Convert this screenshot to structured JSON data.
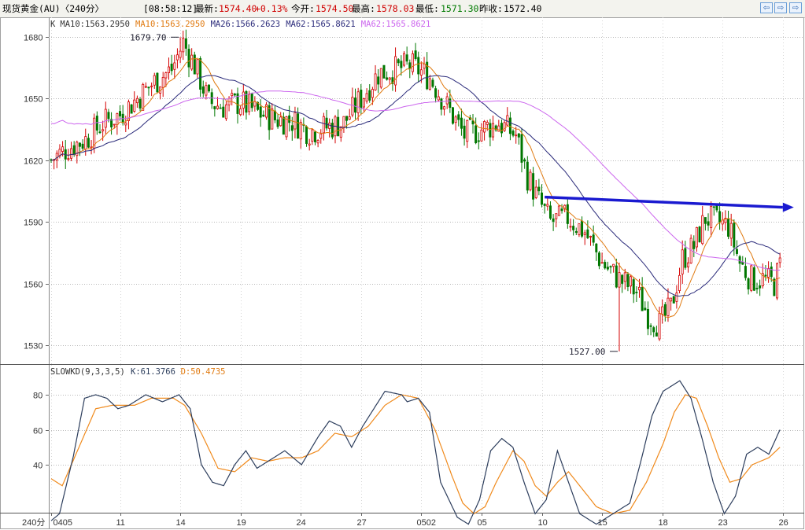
{
  "header": {
    "title": "现货黄金(AU)〈240分〉",
    "time": "[08:58:12]",
    "latest_label": "最新:",
    "latest": "1574.40",
    "change": "+0.13%",
    "open_label": "今开:",
    "open": "1574.50",
    "high_label": "最高:",
    "high": "1578.03",
    "low_label": "最低:",
    "low": "1571.30",
    "prev_label": "昨收:",
    "prev": "1572.40"
  },
  "nav_buttons": [
    "⇦",
    "⇨",
    "⇨"
  ],
  "colors": {
    "up": "#d40000",
    "down": "#007700",
    "ma10": "#e07a10",
    "ma26": "#2a2a7a",
    "ma62": "#cc66ee",
    "k": "#2c3d5c",
    "d": "#f08a1c",
    "arrow": "#1a1ad0",
    "grid": "#b8b8b8"
  },
  "legend_main": [
    {
      "text": "K",
      "color": "#333333"
    },
    {
      "text": "MA10:1563.2950",
      "color": "#333333"
    },
    {
      "text": "MA10:1563.2950",
      "color": "#e07a10"
    },
    {
      "text": "MA26:1566.2623",
      "color": "#2a2a7a"
    },
    {
      "text": "MA62:1565.8621",
      "color": "#2a2a7a"
    },
    {
      "text": "MA62:1565.8621",
      "color": "#cc66ee"
    }
  ],
  "legend_sub": [
    {
      "text": "SLOWKD(9,3,3,5)",
      "color": "#333333"
    },
    {
      "text": "K:61.3766",
      "color": "#2c3d5c"
    },
    {
      "text": "D:50.4735",
      "color": "#e07a10"
    }
  ],
  "chart_data": [
    {
      "type": "candlestick",
      "y_ticks": [
        1530,
        1560,
        1590,
        1620,
        1650,
        1680
      ],
      "ylim": [
        1522,
        1680
      ],
      "x_ticks": [
        {
          "label": "0405",
          "i": 0
        },
        {
          "label": "11",
          "i": 24
        },
        {
          "label": "14",
          "i": 45
        },
        {
          "label": "19",
          "i": 66
        },
        {
          "label": "24",
          "i": 87
        },
        {
          "label": "27",
          "i": 108
        },
        {
          "label": "0502",
          "i": 129
        },
        {
          "label": "05",
          "i": 150
        },
        {
          "label": "10",
          "i": 171
        },
        {
          "label": "15",
          "i": 192
        },
        {
          "label": "18",
          "i": 213
        },
        {
          "label": "23",
          "i": 234
        },
        {
          "label": "26",
          "i": 255
        }
      ],
      "bar_count": 255,
      "x_axis_label": "240分",
      "anchors": [
        [
          0,
          1620
        ],
        [
          6,
          1626
        ],
        [
          12,
          1630
        ],
        [
          18,
          1638
        ],
        [
          24,
          1642
        ],
        [
          30,
          1650
        ],
        [
          36,
          1658
        ],
        [
          42,
          1664
        ],
        [
          46,
          1677
        ],
        [
          50,
          1666
        ],
        [
          55,
          1648
        ],
        [
          60,
          1646
        ],
        [
          66,
          1648
        ],
        [
          72,
          1643
        ],
        [
          78,
          1640
        ],
        [
          84,
          1639
        ],
        [
          90,
          1634
        ],
        [
          96,
          1636
        ],
        [
          102,
          1638
        ],
        [
          108,
          1650
        ],
        [
          114,
          1662
        ],
        [
          120,
          1664
        ],
        [
          125,
          1666
        ],
        [
          128,
          1664
        ],
        [
          132,
          1660
        ],
        [
          138,
          1646
        ],
        [
          144,
          1632
        ],
        [
          150,
          1635
        ],
        [
          156,
          1638
        ],
        [
          162,
          1632
        ],
        [
          166,
          1612
        ],
        [
          170,
          1600
        ],
        [
          174,
          1590
        ],
        [
          180,
          1592
        ],
        [
          186,
          1585
        ],
        [
          192,
          1570
        ],
        [
          198,
          1562
        ],
        [
          204,
          1556
        ],
        [
          208,
          1545
        ],
        [
          212,
          1540
        ],
        [
          216,
          1548
        ],
        [
          220,
          1572
        ],
        [
          224,
          1578
        ],
        [
          228,
          1592
        ],
        [
          232,
          1590
        ],
        [
          236,
          1588
        ],
        [
          240,
          1570
        ],
        [
          244,
          1562
        ],
        [
          248,
          1562
        ],
        [
          252,
          1560
        ],
        [
          255,
          1573
        ]
      ],
      "annotations": [
        {
          "text": "1679.70",
          "i": 45,
          "value": 1679.7,
          "side": "left"
        },
        {
          "text": "1527.00",
          "i": 198,
          "value": 1527.0,
          "side": "left"
        }
      ],
      "trend_arrow": {
        "from": [
          172,
          1602
        ],
        "to": [
          255,
          1597
        ]
      }
    },
    {
      "type": "line",
      "title": "SLOWKD(9,3,3,5)",
      "y_ticks": [
        40,
        60,
        80
      ],
      "ylim": [
        0,
        100
      ],
      "series": [
        {
          "name": "K",
          "anchors": [
            [
              0,
              8
            ],
            [
              3,
              12
            ],
            [
              8,
              45
            ],
            [
              12,
              78
            ],
            [
              16,
              80
            ],
            [
              20,
              78
            ],
            [
              24,
              72
            ],
            [
              28,
              74
            ],
            [
              34,
              80
            ],
            [
              40,
              76
            ],
            [
              46,
              80
            ],
            [
              50,
              72
            ],
            [
              54,
              40
            ],
            [
              58,
              30
            ],
            [
              62,
              28
            ],
            [
              66,
              40
            ],
            [
              70,
              48
            ],
            [
              74,
              38
            ],
            [
              78,
              42
            ],
            [
              84,
              48
            ],
            [
              90,
              40
            ],
            [
              96,
              56
            ],
            [
              100,
              65
            ],
            [
              104,
              62
            ],
            [
              108,
              50
            ],
            [
              112,
              62
            ],
            [
              116,
              72
            ],
            [
              120,
              82
            ],
            [
              126,
              80
            ],
            [
              128,
              76
            ],
            [
              132,
              78
            ],
            [
              136,
              70
            ],
            [
              140,
              30
            ],
            [
              146,
              10
            ],
            [
              150,
              6
            ],
            [
              154,
              20
            ],
            [
              158,
              48
            ],
            [
              162,
              55
            ],
            [
              166,
              50
            ],
            [
              170,
              30
            ],
            [
              174,
              12
            ],
            [
              178,
              20
            ],
            [
              182,
              48
            ],
            [
              186,
              30
            ],
            [
              190,
              12
            ],
            [
              196,
              6
            ],
            [
              202,
              12
            ],
            [
              208,
              18
            ],
            [
              212,
              42
            ],
            [
              216,
              68
            ],
            [
              220,
              82
            ],
            [
              226,
              88
            ],
            [
              230,
              78
            ],
            [
              234,
              55
            ],
            [
              238,
              30
            ],
            [
              242,
              12
            ],
            [
              246,
              22
            ],
            [
              250,
              46
            ],
            [
              254,
              50
            ],
            [
              258,
              46
            ],
            [
              262,
              60
            ]
          ]
        },
        {
          "name": "D",
          "anchors": [
            [
              0,
              32
            ],
            [
              4,
              28
            ],
            [
              10,
              50
            ],
            [
              16,
              72
            ],
            [
              22,
              74
            ],
            [
              30,
              74
            ],
            [
              36,
              78
            ],
            [
              44,
              78
            ],
            [
              48,
              74
            ],
            [
              54,
              58
            ],
            [
              60,
              38
            ],
            [
              66,
              36
            ],
            [
              72,
              44
            ],
            [
              78,
              42
            ],
            [
              84,
              44
            ],
            [
              90,
              44
            ],
            [
              96,
              48
            ],
            [
              102,
              58
            ],
            [
              108,
              56
            ],
            [
              114,
              62
            ],
            [
              120,
              74
            ],
            [
              126,
              80
            ],
            [
              132,
              78
            ],
            [
              138,
              60
            ],
            [
              144,
              34
            ],
            [
              148,
              18
            ],
            [
              152,
              12
            ],
            [
              156,
              16
            ],
            [
              160,
              30
            ],
            [
              166,
              48
            ],
            [
              170,
              42
            ],
            [
              174,
              28
            ],
            [
              178,
              22
            ],
            [
              182,
              30
            ],
            [
              186,
              36
            ],
            [
              190,
              28
            ],
            [
              196,
              16
            ],
            [
              202,
              12
            ],
            [
              208,
              14
            ],
            [
              214,
              30
            ],
            [
              220,
              52
            ],
            [
              224,
              70
            ],
            [
              228,
              80
            ],
            [
              232,
              78
            ],
            [
              236,
              62
            ],
            [
              240,
              44
            ],
            [
              244,
              30
            ],
            [
              248,
              32
            ],
            [
              252,
              40
            ],
            [
              258,
              44
            ],
            [
              262,
              50
            ]
          ]
        }
      ]
    }
  ]
}
